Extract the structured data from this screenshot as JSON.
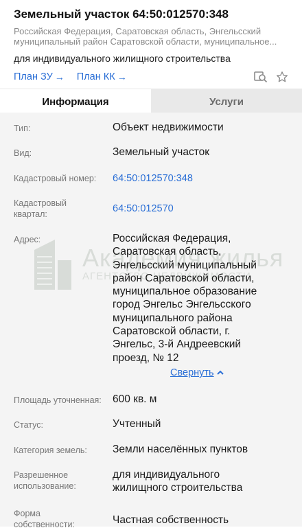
{
  "header": {
    "title": "Земельный участок 64:50:012570:348",
    "address_line1": "Российская Федерация, Саратовская область, Энгельсский",
    "address_line2": "муниципальный район Саратовской области, муниципальное...",
    "purpose": "для индивидуального жилищного строительства",
    "links": [
      {
        "label": "План ЗУ",
        "arrow": "→"
      },
      {
        "label": "План КК",
        "arrow": "→"
      }
    ],
    "icons": [
      "search-map-icon",
      "star-icon"
    ]
  },
  "tabs": [
    {
      "label": "Информация",
      "active": true
    },
    {
      "label": "Услуги",
      "active": false
    }
  ],
  "details": {
    "type": {
      "label": "Тип:",
      "value": "Объект недвижимости"
    },
    "kind": {
      "label": "Вид:",
      "value": "Земельный участок"
    },
    "cadastral_number": {
      "label": "Кадастровый номер:",
      "value": "64:50:012570:348"
    },
    "cadastral_quarter": {
      "label_line1": "Кадастровый",
      "label_line2": "квартал:",
      "value": "64:50:012570"
    },
    "address": {
      "label": "Адрес:",
      "lines": [
        "Российская Федерация,",
        "Саратовская область,",
        "Энгельсский муниципальный",
        "район Саратовской области,",
        "муниципальное образование",
        "город Энгельс Энгельсского",
        "муниципального района",
        "Саратовской области, г.",
        "Энгельс, 3-й Андреевский",
        "проезд, № 12"
      ],
      "collapse_label": "Свернуть"
    },
    "area": {
      "label": "Площадь уточненная:",
      "value": "600 кв. м"
    },
    "status": {
      "label": "Статус:",
      "value": "Учтенный"
    },
    "land_category": {
      "label": "Категория земель:",
      "value": "Земли населённых пунктов"
    },
    "permitted_use": {
      "label_line1": "Разрешенное",
      "label_line2": "использование:",
      "value_line1": "для индивидуального",
      "value_line2": "жилищного строительства"
    },
    "ownership": {
      "label_line1": "Форма",
      "label_line2": "собственности:",
      "value": "Частная собственность"
    }
  },
  "watermark": {
    "line1": "Академия жилья",
    "line2": "АГЕНТСТВО НЕДВИЖИМОСТИ"
  },
  "colors": {
    "link": "#2b6fd6",
    "label": "#777777",
    "rows_bg": "#f4f4f4",
    "tab_inactive_bg": "#e9e9e9"
  }
}
